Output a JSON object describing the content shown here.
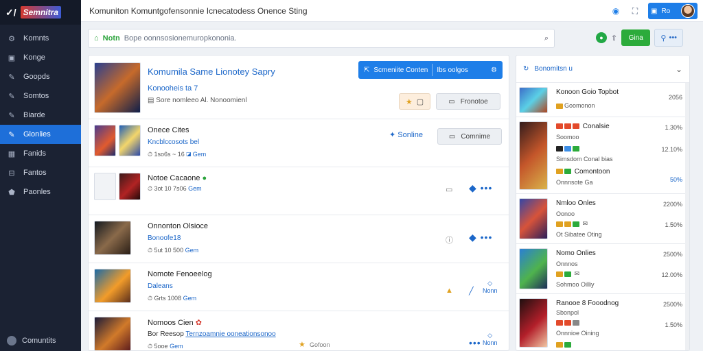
{
  "sidebar": {
    "logo_mark": "✓/",
    "brand": "Semnitra",
    "items": [
      {
        "icon": "gear-icon",
        "label": "Komnts"
      },
      {
        "icon": "document-icon",
        "label": "Konge"
      },
      {
        "icon": "pin-icon",
        "label": "Goopds"
      },
      {
        "icon": "pin-icon",
        "label": "Somtos"
      },
      {
        "icon": "tag-icon",
        "label": "Biarde"
      },
      {
        "icon": "pin-icon",
        "label": "Glonlies",
        "active": true
      },
      {
        "icon": "chart-icon",
        "label": "Fanids"
      },
      {
        "icon": "gift-icon",
        "label": "Fantos"
      },
      {
        "icon": "shield-icon",
        "label": "Paonles"
      }
    ],
    "bottom_label": "Comuntits"
  },
  "topbar": {
    "title": "Komuniton  Komuntgofensonnie  Icnecatodess  Onence Sting",
    "profile_label": "Ro"
  },
  "search": {
    "tag": "Notn",
    "placeholder": "Bope oonnsosionemuropkononia."
  },
  "top_actions": {
    "green_label": "Gina"
  },
  "featured": {
    "title": "Komumila Same  Lionotey Sapry",
    "subtitle": "Konooheis ta 7",
    "meta": "Sore nomleeo Al. Nonoomienl",
    "btn_left": "Scmeniite Conten",
    "btn_right": "Ibs oolgos",
    "action_label": "Fronotoe"
  },
  "rows": [
    {
      "name": "Onece Cites",
      "sub": "Kncblccosots bel",
      "meta": "1so6s ~ 16",
      "meta_link": "Gem",
      "online_label": "Sonline",
      "action_label": "Comnime"
    },
    {
      "name": "Notoe Cacaone",
      "meta": "3ot  10 7s06",
      "meta_link": "Gem"
    },
    {
      "name": "Onnonton Olsioce",
      "sub": "Bonoofe18",
      "meta": "5ut  10 500",
      "meta_link": "Gem"
    },
    {
      "name": "Nomote Fenoeelog",
      "sub": "Daleans",
      "meta": "Grts  1008",
      "meta_link": "Gem",
      "dl_label": "Nonn"
    },
    {
      "name": "Nomoos Cien",
      "sub_prefix": "Bor Reesop",
      "sub": "Ternzoamnie  ooneationsonoo",
      "meta": "5ooe",
      "meta_link": "Gem",
      "action_label": "Gofoon",
      "dl_label": "Nonn"
    }
  ],
  "right_panel": {
    "header": "Bonomitsn u",
    "items": [
      {
        "title": "Konoon Goio  Topbot",
        "sub": "Goomonon",
        "pct": "2056"
      },
      {
        "title": "Conalsie",
        "sub": "Soomoo",
        "sub2": "Simsdom Conal bias",
        "pct": "1.30%",
        "pct2": "12.10%",
        "extra": "Comontoon",
        "extra_sub": "Onnnsote Ga",
        "pct3": "50%"
      },
      {
        "title": "Nmloo Onles",
        "sub": "Oonoo",
        "sub2": "Ot Sibatee Oting",
        "pct": "2200%",
        "pct2": "1.50%"
      },
      {
        "title": "Nomo Onlies",
        "sub": "Onnnos",
        "sub2": "Sohmoo Oilliy",
        "pct": "2500%",
        "pct2": "12.00%"
      },
      {
        "title": "Ranooe 8 Fooodnog",
        "sub": "Sbonpol",
        "sub2": "Onnnioe Oining",
        "pct": "2500%",
        "pct2": "1.50%"
      }
    ]
  }
}
